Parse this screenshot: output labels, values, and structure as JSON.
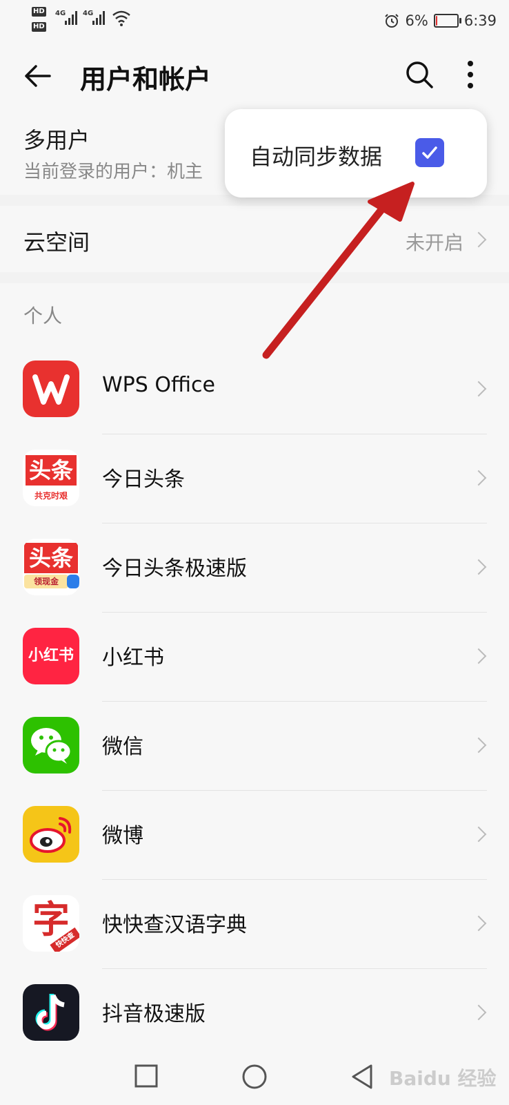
{
  "status_bar": {
    "hd1": "HD",
    "hd2": "HD",
    "sim1": "4G",
    "sim2": "4G",
    "battery_percent": "6%",
    "battery_level": 0.06,
    "time": "6:39",
    "icons": [
      "signal-icon",
      "wifi-icon",
      "alarm-icon",
      "battery-icon"
    ]
  },
  "header": {
    "title": "用户和帐户",
    "icons": [
      "back-arrow-icon",
      "search-icon",
      "more-vert-icon"
    ]
  },
  "multi_user": {
    "title": "多用户",
    "subtitle": "当前登录的用户：机主"
  },
  "cloud": {
    "title": "云空间",
    "value": "未开启"
  },
  "personal": {
    "section_label": "个人",
    "accounts": [
      {
        "name": "WPS Office",
        "icon": "wps-office-icon",
        "color": "#e8312f"
      },
      {
        "name": "今日头条",
        "icon": "toutiao-icon",
        "color": "#e8312f",
        "icon_text": "头条",
        "icon_sub": "共克时艰"
      },
      {
        "name": "今日头条极速版",
        "icon": "toutiao-lite-icon",
        "color": "#e8312f",
        "icon_text": "头条",
        "icon_sub": "领现金"
      },
      {
        "name": "小红书",
        "icon": "xiaohongshu-icon",
        "color": "#ff2442",
        "icon_text": "小红书"
      },
      {
        "name": "微信",
        "icon": "wechat-icon",
        "color": "#2dc100"
      },
      {
        "name": "微博",
        "icon": "weibo-icon",
        "color": "#f5c518"
      },
      {
        "name": "快快查汉语字典",
        "icon": "kuaikuaicha-icon",
        "color": "#d62b2b",
        "icon_text": "字",
        "icon_sub": "快快查"
      },
      {
        "name": "抖音极速版",
        "icon": "douyin-lite-icon",
        "color": "#161823"
      }
    ]
  },
  "popup": {
    "label": "自动同步数据",
    "checked": true,
    "accent": "#4a5be8"
  },
  "navigation": {
    "icons": [
      "recent-apps-icon",
      "home-icon",
      "back-icon"
    ]
  },
  "watermark": {
    "text": "Baidu 经验"
  },
  "annotation": {
    "arrow_color": "#c62020"
  }
}
